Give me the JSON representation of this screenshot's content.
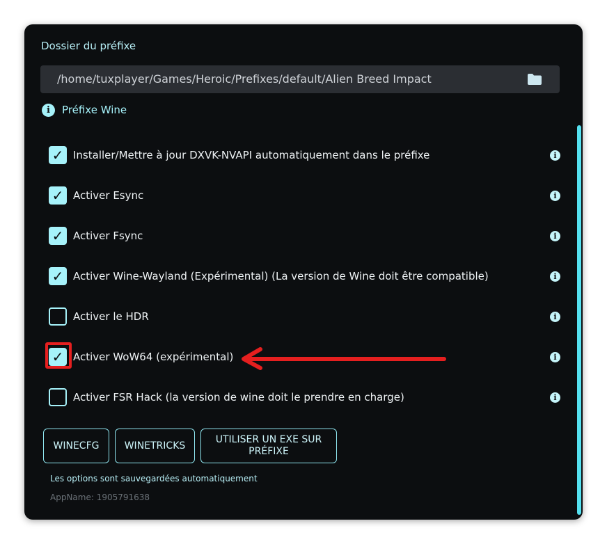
{
  "prefix_folder": {
    "label": "Dossier du préfixe",
    "path": "/home/tuxplayer/Games/Heroic/Prefixes/default/Alien Breed Impact"
  },
  "wine_prefix": {
    "label": "Préfixe Wine",
    "info_glyph": "i"
  },
  "options": [
    {
      "label": "Installer/Mettre à jour DXVK-NVAPI automatiquement dans le préfixe",
      "checked": true
    },
    {
      "label": "Activer Esync",
      "checked": true
    },
    {
      "label": "Activer Fsync",
      "checked": true
    },
    {
      "label": "Activer Wine-Wayland (Expérimental) (La version de Wine doit être compatible)",
      "checked": true
    },
    {
      "label": "Activer le HDR",
      "checked": false
    },
    {
      "label": "Activer WoW64 (expérimental)",
      "checked": true
    },
    {
      "label": "Activer FSR Hack (la version de wine doit le prendre en charge)",
      "checked": false
    }
  ],
  "glyphs": {
    "check": "✓",
    "info": "i"
  },
  "buttons": {
    "winecfg": "WINECFG",
    "winetricks": "WINETRICKS",
    "run_exe": "UTILISER UN EXE SUR PRÉFIXE"
  },
  "footer": {
    "autosave_note": "Les options sont sauvegardées automatiquement",
    "appname": "AppName:  1905791638"
  },
  "colors": {
    "accent": "#a6f2fa",
    "background": "#0c0e10",
    "field": "#2b2e33",
    "highlight": "#e51f1f"
  },
  "annotation": {
    "highlighted_option": "Activer WoW64 (expérimental)",
    "icon": "red-arrow-left"
  }
}
